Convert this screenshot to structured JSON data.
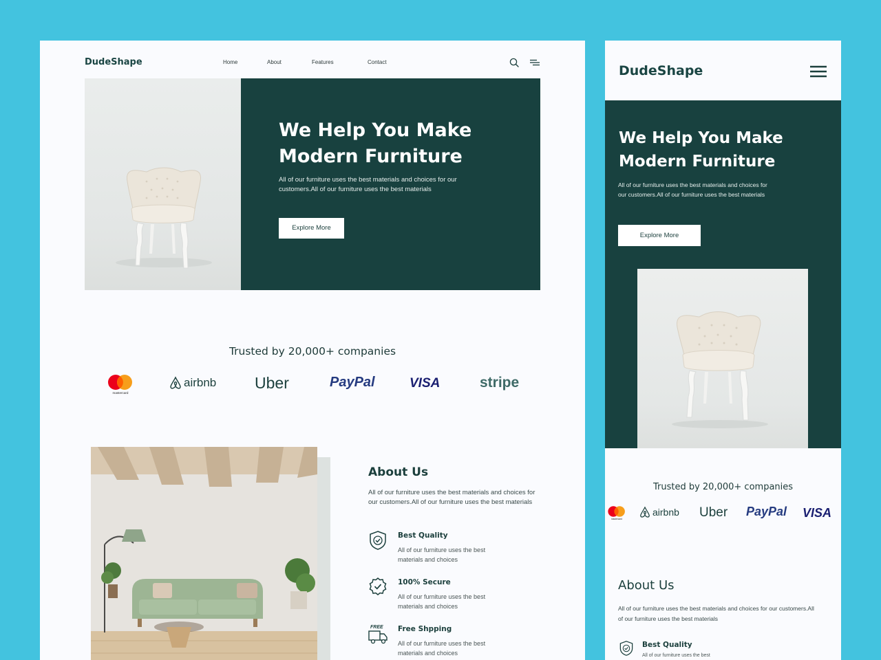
{
  "colors": {
    "background": "#43c3df",
    "brand_green": "#18413f",
    "card": "#fafbfe"
  },
  "desktop": {
    "logo": "DudeShape",
    "nav": [
      "Home",
      "About",
      "Features",
      "Contact"
    ],
    "hero": {
      "title": "We Help You Make Modern Furniture",
      "text": "All of our furniture uses the best materials and choices for our customers.All of our furniture uses the best materials",
      "button": "Explore More"
    },
    "trusted": "Trusted by 20,000+ companies",
    "logos": [
      "mastercard",
      "airbnb",
      "Uber",
      "PayPal",
      "VISA",
      "stripe"
    ],
    "about": {
      "title": "About Us",
      "text": "All of our furniture uses the best materials and choices for our customers.All of our furniture uses the best materials",
      "features": [
        {
          "title": "Best Quality",
          "text": "All of our furniture uses the best materials and choices",
          "icon": "shield-check-icon"
        },
        {
          "title": "100% Secure",
          "text": "All of our furniture uses the best materials and choices",
          "icon": "badge-check-icon"
        },
        {
          "title": "Free Shpping",
          "text": "All of our furniture uses the best materials and choices",
          "icon": "free-truck-icon",
          "icon_label": "FREE"
        }
      ]
    }
  },
  "mobile": {
    "logo": "DudeShape",
    "hero": {
      "title": "We Help You Make Modern Furniture",
      "text": "All of our furniture uses the best materials and choices for our customers.All of our furniture uses the best materials",
      "button": "Explore More"
    },
    "trusted": "Trusted by 20,000+ companies",
    "about": {
      "title": "About Us",
      "text": "All of our furniture uses the best materials and choices for our customers.All of our furniture uses the best materials",
      "feature_title": "Best Quality",
      "feature_text": "All of our furniture uses the best"
    }
  }
}
